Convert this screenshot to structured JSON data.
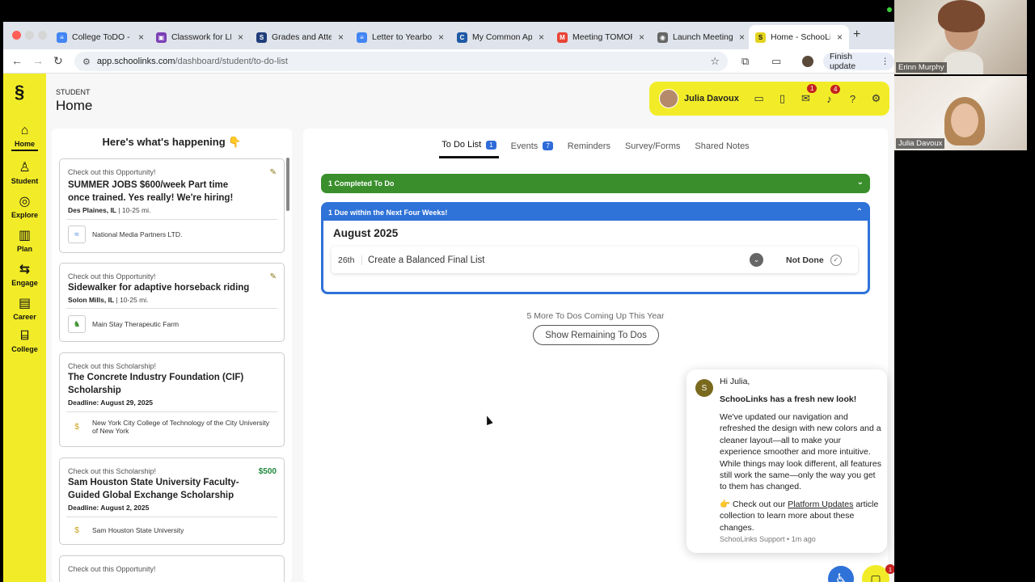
{
  "browser": {
    "tabs": [
      {
        "label": "College ToDO - G",
        "icon": "docs-icon",
        "color": "#4285f4"
      },
      {
        "label": "Classwork for LH",
        "icon": "classroom-icon",
        "color": "#7b3fb5"
      },
      {
        "label": "Grades and Atten",
        "icon": "sis-icon",
        "color": "#1f3d7a"
      },
      {
        "label": "Letter to Yearboo",
        "icon": "docs-icon",
        "color": "#4285f4"
      },
      {
        "label": "My Common App",
        "icon": "commonapp-icon",
        "color": "#1f5aa6"
      },
      {
        "label": "Meeting TOMORR",
        "icon": "gmail-icon",
        "color": "#ea4335"
      },
      {
        "label": "Launch Meeting",
        "icon": "zoom-icon",
        "color": "#666666"
      },
      {
        "label": "Home - SchooLin",
        "icon": "schoolinks-icon",
        "color": "#e3d31e"
      }
    ],
    "url_domain": "app.schoolinks.com",
    "url_path": "/dashboard/student/to-do-list",
    "finish_update": "Finish update"
  },
  "nav": {
    "items": [
      {
        "label": "Home",
        "icon": "⌂"
      },
      {
        "label": "Student",
        "icon": "♙"
      },
      {
        "label": "Explore",
        "icon": "◎"
      },
      {
        "label": "Plan",
        "icon": "▥"
      },
      {
        "label": "Engage",
        "icon": "⇆"
      },
      {
        "label": "Career",
        "icon": "▤"
      },
      {
        "label": "College",
        "icon": "⌸"
      }
    ]
  },
  "header": {
    "kicker": "STUDENT",
    "title": "Home"
  },
  "user": {
    "name": "Julia Davoux",
    "messages_badge": "1",
    "notifications_badge": "4"
  },
  "feed": {
    "title": "Here's what's happening 👇",
    "cards": [
      {
        "kicker": "Check out this Opportunity!",
        "title": "SUMMER JOBS $600/week Part time once trained. Yes really! We're hiring!",
        "location": "Des Plaines, IL",
        "distance": " | 10-25 mi.",
        "org": "National Media Partners LTD.",
        "amount": ""
      },
      {
        "kicker": "Check out this Opportunity!",
        "title": "Sidewalker for adaptive horseback riding",
        "location": "Solon Mills, IL",
        "distance": " | 10-25 mi.",
        "org": "Main Stay Therapeutic Farm",
        "amount": ""
      },
      {
        "kicker": "Check out this Scholarship!",
        "title": "The Concrete Industry Foundation (CIF) Scholarship",
        "deadline": "Deadline: August 29, 2025",
        "org": "New York City College of Technology of the City University of New York",
        "amount": ""
      },
      {
        "kicker": "Check out this Scholarship!",
        "title": "Sam Houston State University Faculty-Guided Global Exchange Scholarship",
        "deadline": "Deadline: August 2, 2025",
        "org": "Sam Houston State University",
        "amount": "$500"
      },
      {
        "kicker": "Check out this Opportunity!"
      }
    ]
  },
  "main": {
    "tabs": [
      {
        "label": "To Do List",
        "badge": "1"
      },
      {
        "label": "Events",
        "badge": "7"
      },
      {
        "label": "Reminders",
        "badge": ""
      },
      {
        "label": "Survey/Forms",
        "badge": ""
      },
      {
        "label": "Shared Notes",
        "badge": ""
      }
    ],
    "completed_label": "1 Completed To Do",
    "due_label": "1 Due within the Next Four Weeks!",
    "month": "August 2025",
    "todo": {
      "date": "26th",
      "name": "Create a Balanced Final List",
      "status": "Not Done"
    },
    "more_text": "5 More To Dos Coming Up This Year",
    "show_button": "Show Remaining To Dos"
  },
  "chat": {
    "avatar": "S",
    "greeting": "Hi Julia,",
    "headline": "SchooLinks has a fresh new look!",
    "body": "We've updated our navigation and refreshed the design with new colors and a cleaner layout—all to make your experience smoother and more intuitive. While things may look different, all features still work the same—only the way you get to them has changed.",
    "cta_prefix": "👉 Check out our ",
    "cta_link": "Platform Updates",
    "cta_suffix": " article collection to learn more about these changes.",
    "footer": "SchooLinks Support • 1m ago",
    "launcher_badge": "1"
  },
  "video": {
    "participant1": "Erinn Murphy",
    "participant2": "Julia Davoux"
  },
  "colors": {
    "brand_yellow": "#f2ec28",
    "completed_green": "#3a8f2c",
    "due_blue": "#2f72d8",
    "badge_red": "#c5221f"
  }
}
